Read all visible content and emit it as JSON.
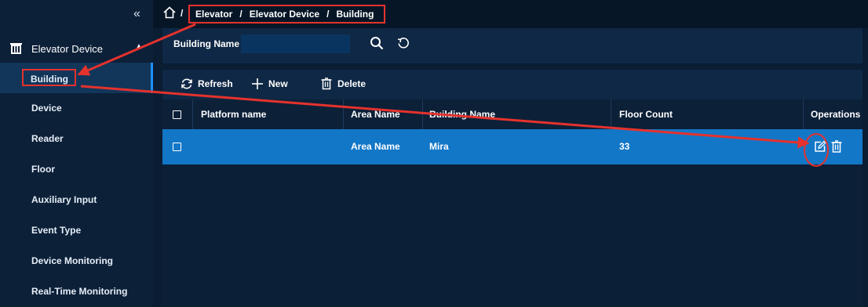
{
  "sidebar": {
    "collapse_glyph": "«",
    "group": {
      "label": "Elevator Device",
      "icon": "building-icon",
      "expanded": true
    },
    "items": [
      {
        "label": "Building",
        "active": true
      },
      {
        "label": "Device"
      },
      {
        "label": "Reader"
      },
      {
        "label": "Floor"
      },
      {
        "label": "Auxiliary Input"
      },
      {
        "label": "Event Type"
      },
      {
        "label": "Device Monitoring"
      },
      {
        "label": "Real-Time Monitoring"
      }
    ]
  },
  "breadcrumb": {
    "separator": "/",
    "items": [
      "Elevator",
      "Elevator Device",
      "Building"
    ]
  },
  "filter": {
    "label": "Building Name",
    "value": "",
    "placeholder": ""
  },
  "toolbar": {
    "refresh": "Refresh",
    "new": "New",
    "delete": "Delete"
  },
  "table": {
    "columns": [
      "Platform name",
      "Area Name",
      "Building Name",
      "Floor Count",
      "Operations"
    ],
    "rows": [
      {
        "platform_name": "",
        "area_name": "Area Name",
        "building_name": "Mira",
        "floor_count": "33",
        "selected": true
      }
    ]
  },
  "colors": {
    "accent": "#1377c7",
    "annotation": "#e5322d",
    "background": "#0a1d33"
  }
}
